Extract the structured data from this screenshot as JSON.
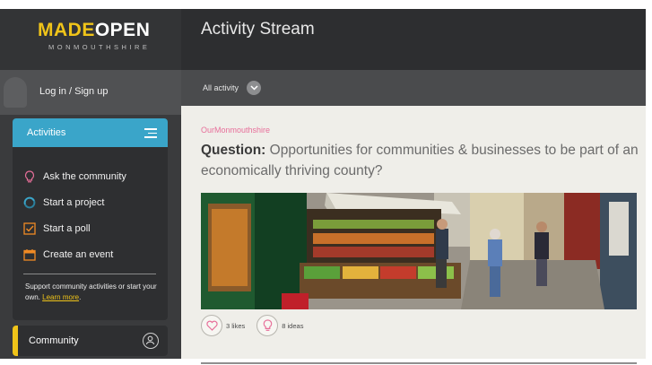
{
  "brand": {
    "made": "MADE",
    "open": "OPEN",
    "sub": "MONMOUTHSHIRE"
  },
  "sidebar": {
    "login_label": "Log in / Sign up",
    "activities_header": "Activities",
    "items": [
      {
        "label": "Ask the community",
        "icon": "lightbulb-icon"
      },
      {
        "label": "Start a project",
        "icon": "project-icon"
      },
      {
        "label": "Start a poll",
        "icon": "poll-checkbox-icon"
      },
      {
        "label": "Create an event",
        "icon": "calendar-icon"
      }
    ],
    "support_text": "Support community activities or start your own.",
    "learn_more": "Learn more",
    "community_label": "Community"
  },
  "header": {
    "title": "Activity Stream"
  },
  "filter": {
    "label": "All activity"
  },
  "card": {
    "source": "OurMonmouthshire",
    "question_prefix": "Question:",
    "question_text": " Opportunities for communities & businesses to be part of an economically thriving county?",
    "likes": "3 likes",
    "ideas": "8 ideas"
  },
  "colors": {
    "brand_yellow": "#f0c419",
    "accent_blue": "#3aa5c9",
    "source_pink": "#e76f9a"
  }
}
